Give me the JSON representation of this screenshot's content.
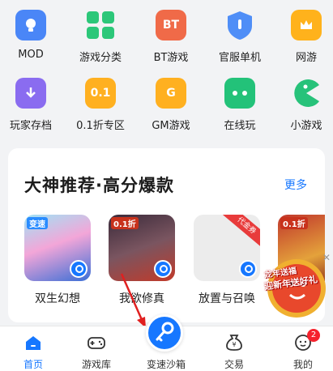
{
  "grid": {
    "row1": [
      {
        "label": "MOD",
        "icon": "lightbulb-icon",
        "color": "#4a86f7"
      },
      {
        "label": "游戏分类",
        "icon": "category-grid-icon",
        "color": "#2cc779"
      },
      {
        "label": "BT游戏",
        "icon": "bt-icon",
        "color": "#f06a48",
        "text": "BT"
      },
      {
        "label": "官服单机",
        "icon": "shield-icon",
        "color": "#4f8ef7"
      },
      {
        "label": "网游",
        "icon": "crown-icon",
        "color": "#ffb21c"
      }
    ],
    "row2": [
      {
        "label": "玩家存档",
        "icon": "archive-icon",
        "color": "#8a6cf0"
      },
      {
        "label": "0.1折专区",
        "icon": "discount-icon",
        "color": "#ffb020",
        "text": "0.1"
      },
      {
        "label": "GM游戏",
        "icon": "gm-icon",
        "color": "#ffb020",
        "text": "G"
      },
      {
        "label": "在线玩",
        "icon": "gamepad-icon",
        "color": "#23c279"
      },
      {
        "label": "小游戏",
        "icon": "pacman-icon",
        "color": "#27c27a"
      }
    ]
  },
  "recommend": {
    "title": "大神推荐·高分爆款",
    "more": "更多",
    "games": [
      {
        "name": "双生幻想",
        "tag": "变速"
      },
      {
        "name": "我欲修真",
        "tag": "0.1折"
      },
      {
        "name": "放置与召唤",
        "tag": "代金券"
      },
      {
        "name": "",
        "tag": "0.1折"
      }
    ]
  },
  "promo": {
    "line1": "龙年送福",
    "line2": "迎新年送好礼"
  },
  "tabs": [
    {
      "label": "首页",
      "active": true
    },
    {
      "label": "游戏库"
    },
    {
      "label": "变速沙箱"
    },
    {
      "label": "交易"
    },
    {
      "label": "我的",
      "badge": "2"
    }
  ],
  "colors": {
    "accent": "#1677ff",
    "badge": "#f5222d"
  }
}
